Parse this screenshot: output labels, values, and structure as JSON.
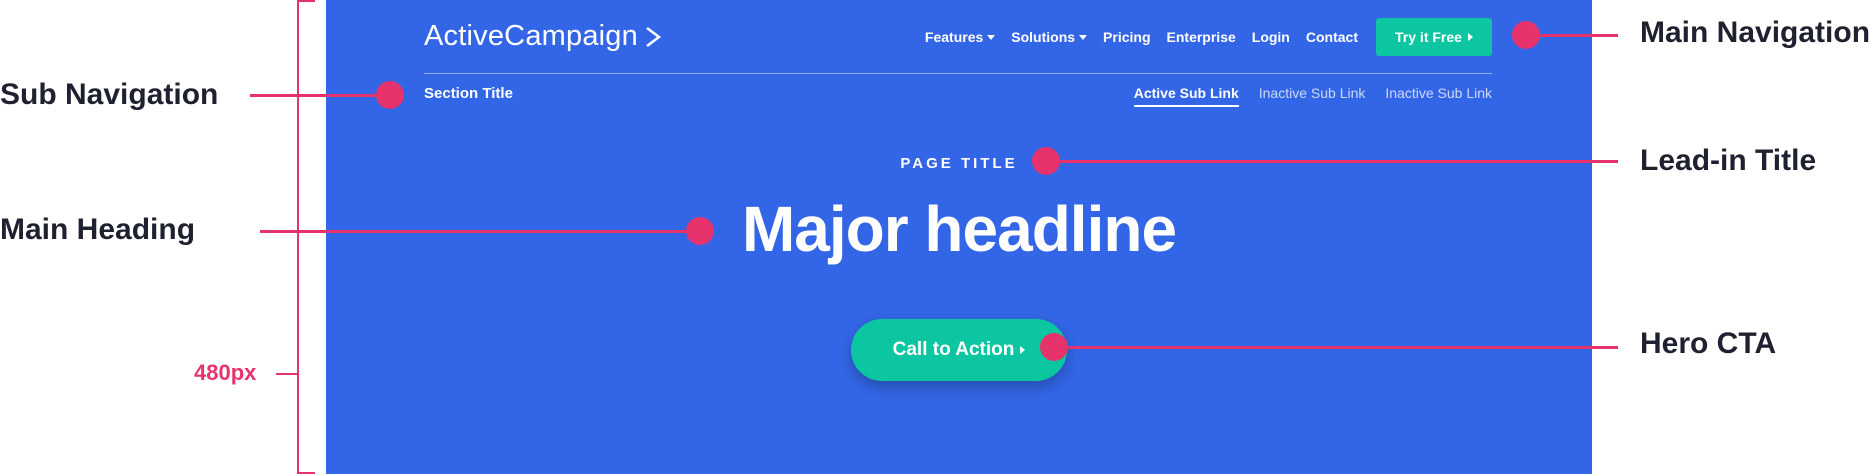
{
  "brand": {
    "logo_text": "ActiveCampaign"
  },
  "main_nav": {
    "items": [
      {
        "label": "Features",
        "dropdown": true
      },
      {
        "label": "Solutions",
        "dropdown": true
      },
      {
        "label": "Pricing",
        "dropdown": false
      },
      {
        "label": "Enterprise",
        "dropdown": false
      },
      {
        "label": "Login",
        "dropdown": false
      },
      {
        "label": "Contact",
        "dropdown": false
      }
    ],
    "try_button": "Try it Free"
  },
  "sub_nav": {
    "section_title": "Section Title",
    "links": [
      {
        "label": "Active Sub Link",
        "active": true
      },
      {
        "label": "Inactive Sub Link",
        "active": false
      },
      {
        "label": "Inactive Sub Link",
        "active": false
      }
    ]
  },
  "hero": {
    "leadin": "PAGE TITLE",
    "headline": "Major headline",
    "cta": "Call to Action"
  },
  "annotations": {
    "main_navigation": "Main Navigation",
    "sub_navigation": "Sub Navigation",
    "lead_in_title": "Lead-in Title",
    "main_heading": "Main Heading",
    "hero_cta": "Hero CTA",
    "height_label": "480px"
  },
  "colors": {
    "hero_bg": "#3366e6",
    "accent_green": "#0bc6a0",
    "annotation_pink": "#e6336b"
  }
}
